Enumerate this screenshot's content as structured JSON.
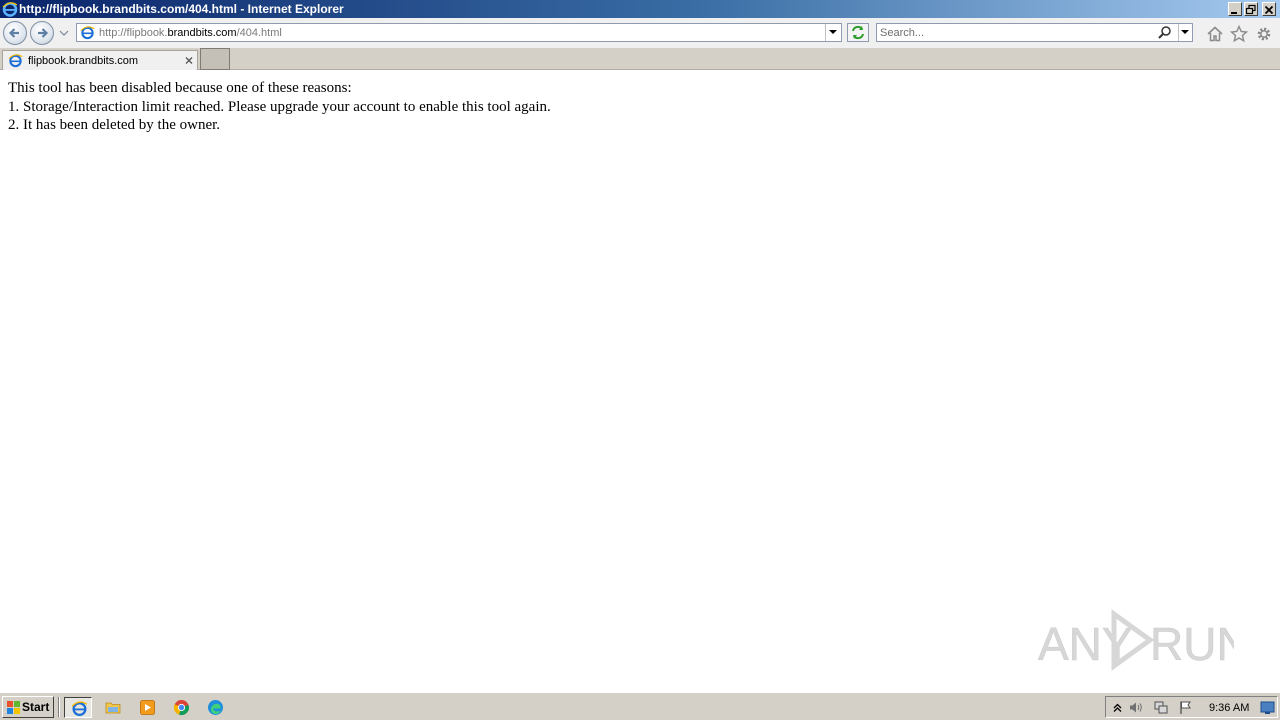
{
  "window": {
    "title": "http://flipbook.brandbits.com/404.html - Internet Explorer"
  },
  "navbar": {
    "address_prefix": "http://flipbook.",
    "address_host": "brandbits.com",
    "address_path": "/404.html",
    "search_placeholder": "Search..."
  },
  "tabs": [
    {
      "label": "flipbook.brandbits.com"
    }
  ],
  "content": {
    "lines": [
      "This tool has been disabled because one of these reasons:",
      "1. Storage/Interaction limit reached. Please upgrade your account to enable this tool again.",
      "2. It has been deleted by the owner."
    ]
  },
  "watermark": {
    "text_left": "ANY",
    "text_right": "RUN"
  },
  "taskbar": {
    "start_label": "Start",
    "clock": "9:36 AM"
  },
  "colors": {
    "titlebar_start": "#0a246a",
    "titlebar_end": "#a6caf0",
    "ie_blue": "#1b6fd6",
    "chrome_face": "#d4d0c8"
  }
}
